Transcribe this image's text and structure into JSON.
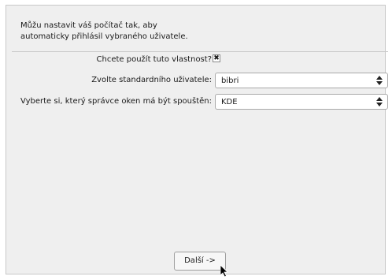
{
  "intro": {
    "line1": "Můžu nastavit váš počítač tak, aby",
    "line2": "automaticky přihlásil vybraného uživatele."
  },
  "form": {
    "enable_label": "Chcete použít tuto vlastnost?",
    "enable_checked_glyph": "✖",
    "user_label": "Zvolte standardního uživatele:",
    "user_value": "bibri",
    "wm_label": "Vyberte si, který správce oken má být spouštěn:",
    "wm_value": "KDE"
  },
  "footer": {
    "next_label": "Další ->"
  }
}
